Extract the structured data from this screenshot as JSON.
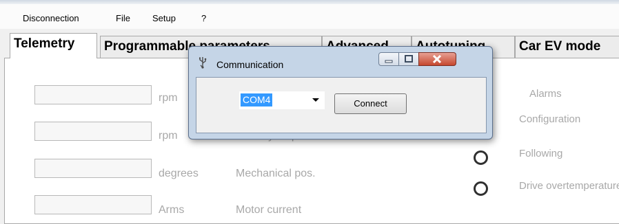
{
  "menubar": {
    "items": [
      "Disconnection",
      "File",
      "Setup",
      "?"
    ]
  },
  "tabs": [
    "Telemetry",
    "Programmable parameters",
    "Advanced",
    "Autotuning",
    "Car EV mode"
  ],
  "telemetry": {
    "rows": [
      {
        "value": "",
        "unit": "rpm",
        "label": ""
      },
      {
        "value": "",
        "unit": "rpm",
        "label": "Velocity setpoint"
      },
      {
        "value": "",
        "unit": "degrees",
        "label": "Mechanical pos."
      },
      {
        "value": "",
        "unit": "Arms",
        "label": "Motor current"
      }
    ],
    "alarms_title": "Alarms",
    "alarms": [
      "Configuration",
      "Following",
      "Drive overtemperature"
    ]
  },
  "dialog": {
    "title": "Communication",
    "port_value": "COM4",
    "connect_label": "Connect"
  }
}
